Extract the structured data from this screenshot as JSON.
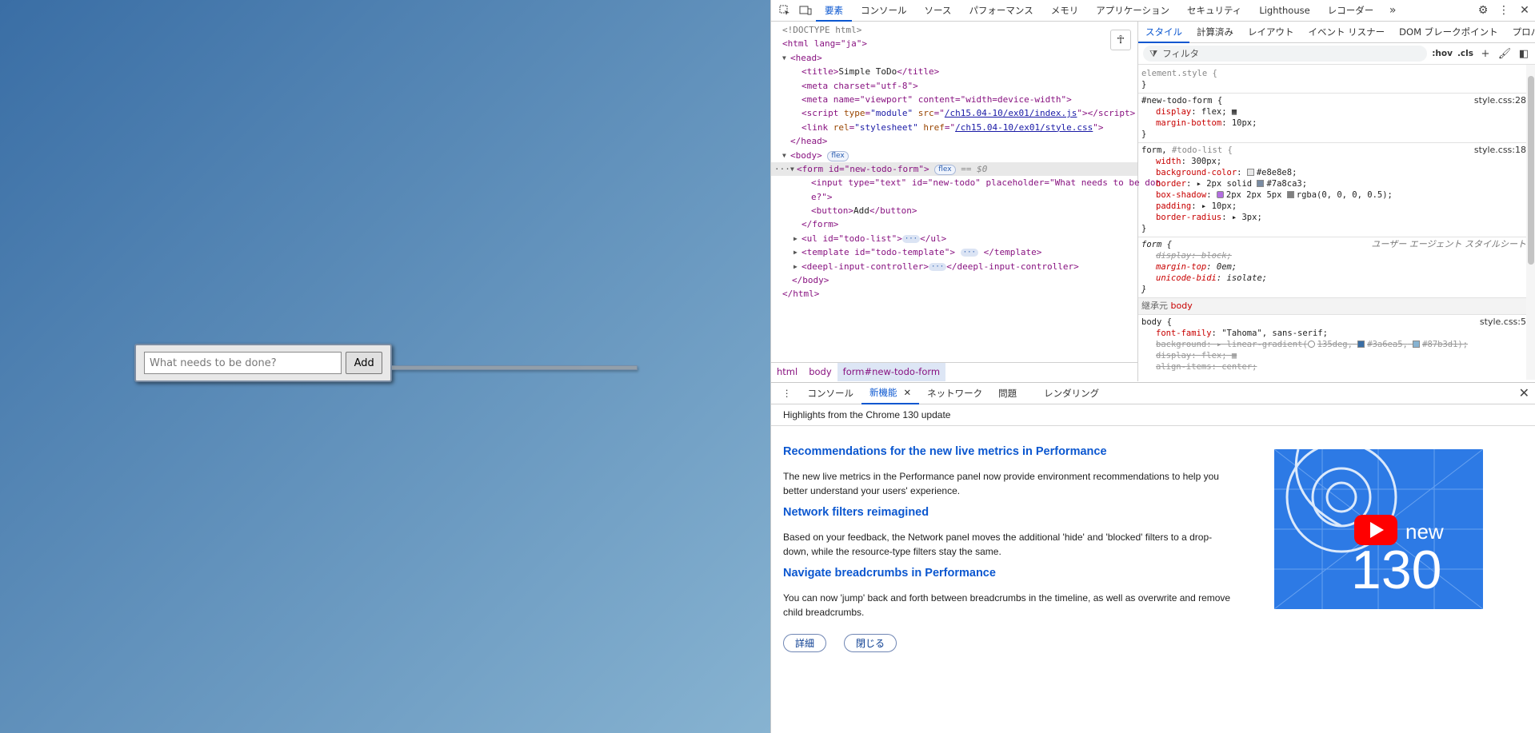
{
  "page": {
    "input_placeholder": "What needs to be done?",
    "add_label": "Add"
  },
  "devtools": {
    "toolbar_tabs": [
      "要素",
      "コンソール",
      "ソース",
      "パフォーマンス",
      "メモリ",
      "アプリケーション",
      "セキュリティ",
      "Lighthouse",
      "レコーダー"
    ],
    "active_tab": "要素",
    "elements": {
      "dom": {
        "doctype": "<!DOCTYPE html>",
        "html_open": "<html lang=\"ja\">",
        "head_open": "<head>",
        "title_open": "<title>",
        "title_text": "Simple ToDo",
        "title_close": "</title>",
        "meta_charset": "<meta charset=\"utf-8\">",
        "meta_viewport": "<meta name=\"viewport\" content=\"width=device-width\">",
        "script_src": "/ch15.04-10/ex01/index.js",
        "link_href": "/ch15.04-10/ex01/style.css",
        "head_close": "</head>",
        "body_open": "<body>",
        "flex_badge": "flex",
        "form_open": "<form id=\"new-todo-form\">",
        "selected_marker": "== $0",
        "input_line1": "<input type=\"text\" id=\"new-todo\" placeholder=\"What needs to be don",
        "input_line2": "e?\">",
        "button_open": "<button>",
        "button_text": "Add",
        "button_close": "</button>",
        "form_close": "</form>",
        "ul_open": "<ul id=\"todo-list\">",
        "ul_close": "</ul>",
        "template_open": "<template id=\"todo-template\">",
        "template_close": "</template>",
        "deepl_open": "<deepl-input-controller>",
        "deepl_close": "</deepl-input-controller>",
        "body_close": "</body>",
        "html_close": "</html>"
      },
      "breadcrumbs": [
        "html",
        "body",
        "form#new-todo-form"
      ]
    },
    "styles": {
      "tabs": [
        "スタイル",
        "計算済み",
        "レイアウト",
        "イベント リスナー",
        "DOM ブレークポイント",
        "プロパティ"
      ],
      "active_tab": "スタイル",
      "filter_placeholder": "フィルタ",
      "hov": ":hov",
      "cls": ".cls",
      "rules": {
        "element_style": "element.style {",
        "close": "}",
        "r1_selector": "#new-todo-form {",
        "r1_source": "style.css:28",
        "r1_p1_name": "display",
        "r1_p1_value": "flex;",
        "r1_p2_name": "margin-bottom",
        "r1_p2_value": "10px;",
        "r2_selector_a": "form,",
        "r2_selector_b": "#todo-list {",
        "r2_source": "style.css:18",
        "r2_width_name": "width",
        "r2_width_value": "300px;",
        "r2_bg_name": "background-color",
        "r2_bg_value": "#e8e8e8;",
        "r2_border_name": "border",
        "r2_border_value": "2px solid",
        "r2_border_color": "#7a8ca3;",
        "r2_shadow_name": "box-shadow",
        "r2_shadow_value": "2px 2px 5px",
        "r2_shadow_color": "rgba(0, 0, 0, 0.5);",
        "r2_padding_name": "padding",
        "r2_padding_value": "10px;",
        "r2_radius_name": "border-radius",
        "r2_radius_value": "3px;",
        "ua_selector": "form {",
        "ua_source": "ユーザー エージェント スタイルシート",
        "ua_p1_name": "display",
        "ua_p1_value": "block;",
        "ua_p2_name": "margin-top",
        "ua_p2_value": "0em;",
        "ua_p3_name": "unicode-bidi",
        "ua_p3_value": "isolate;",
        "inherit_label": "継承元",
        "inherit_from": "body",
        "body_selector": "body {",
        "body_source": "style.css:5",
        "body_ff_name": "font-family",
        "body_ff_value": "\"Tahoma\", sans-serif;",
        "body_bg_name": "background",
        "body_bg_value": "linear-gradient(",
        "body_bg_angle": "135deg,",
        "body_bg_c1": "#3a6ea5,",
        "body_bg_c2": "#87b3d1);",
        "body_disp_name": "display",
        "body_disp_value": "flex;",
        "body_align_name": "align-items",
        "body_align_value": "center;"
      }
    },
    "drawer": {
      "tabs": [
        "コンソール",
        "新機能",
        "ネットワーク",
        "問題",
        "レンダリング"
      ],
      "active_tab": "新機能",
      "whats_new": {
        "header": "Highlights from the Chrome 130 update",
        "items": [
          {
            "title": "Recommendations for the new live metrics in Performance",
            "text": "The new live metrics in the Performance panel now provide environment recommendations to help you better understand your users' experience."
          },
          {
            "title": "Network filters reimagined",
            "text": "Based on your feedback, the Network panel moves the additional 'hide' and 'blocked' filters to a drop-down, while the resource-type filters stay the same."
          },
          {
            "title": "Navigate breadcrumbs in Performance",
            "text": "You can now 'jump' back and forth between breadcrumbs in the timeline, as well as overwrite and remove child breadcrumbs."
          }
        ],
        "details_button": "詳細",
        "close_button": "閉じる",
        "image_word": "new",
        "image_number": "130"
      }
    }
  }
}
